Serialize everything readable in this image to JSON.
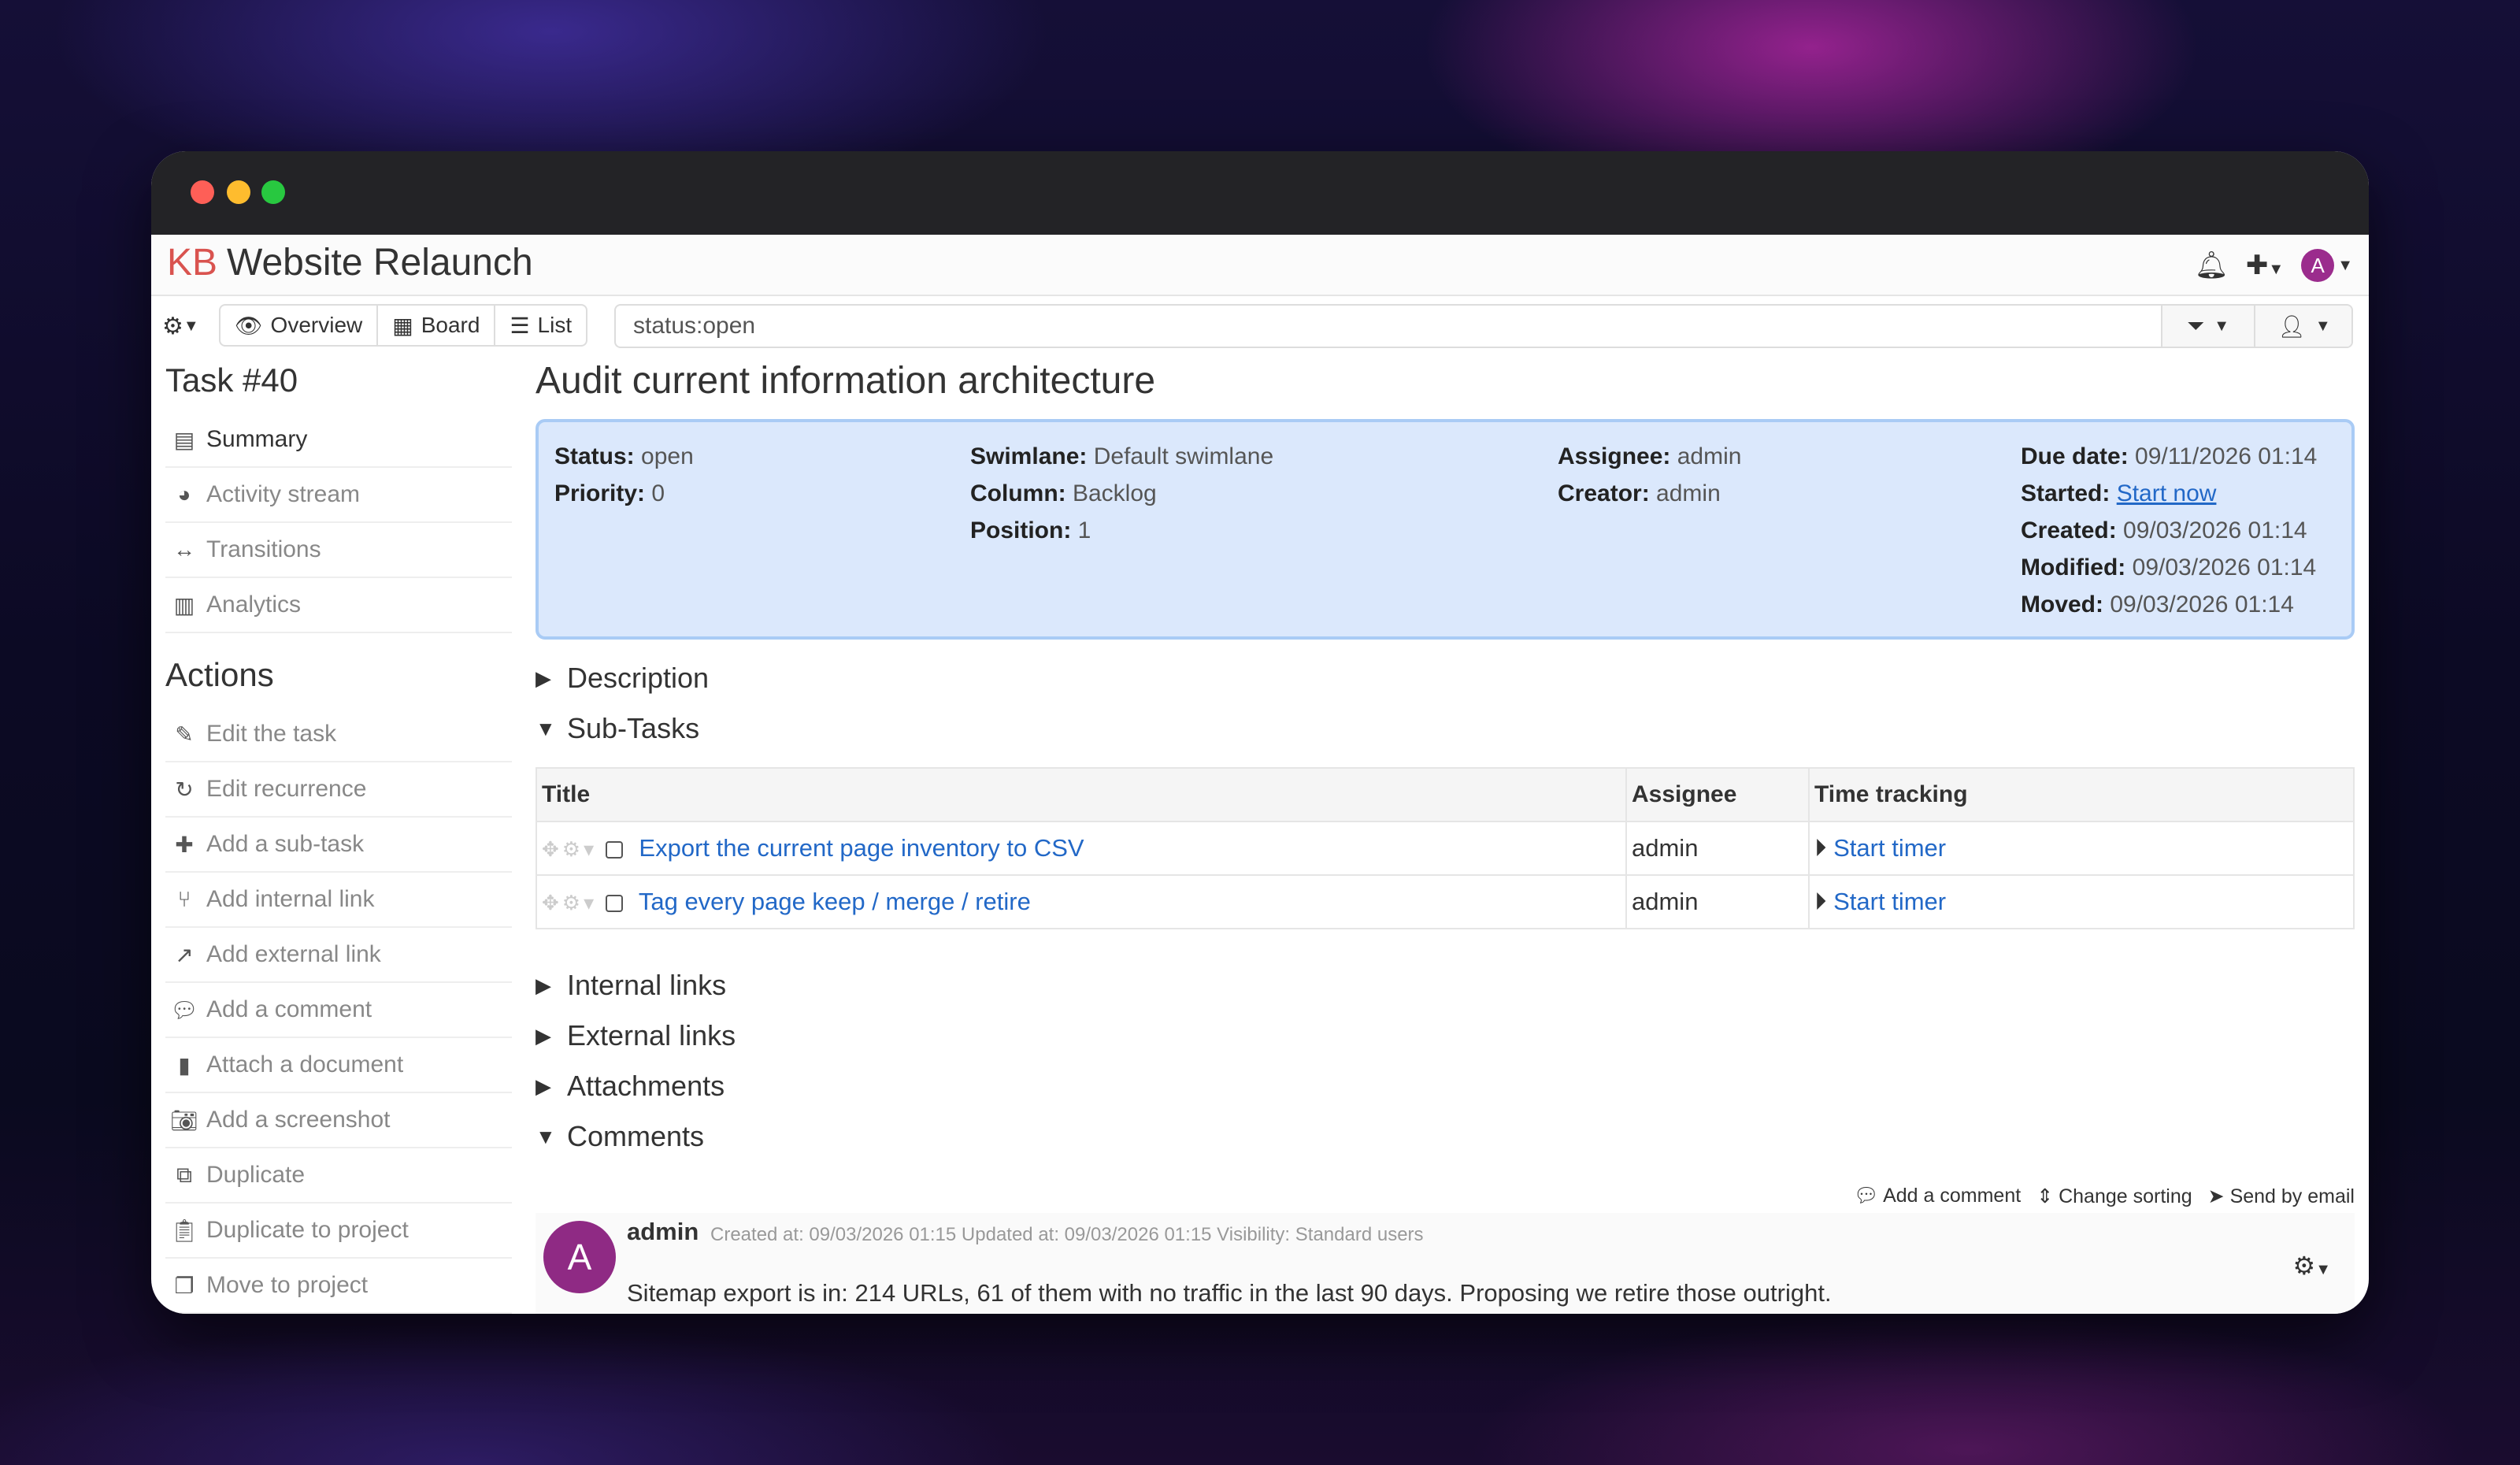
{
  "header": {
    "logo": "KB",
    "project_title": "Website Relaunch",
    "icons": [
      "bell-icon",
      "plus-icon",
      "avatar"
    ],
    "avatar_initial": "A"
  },
  "toolbar": {
    "views": [
      {
        "label": "Overview",
        "icon": "eye-icon"
      },
      {
        "label": "Board",
        "icon": "grid-icon"
      },
      {
        "label": "List",
        "icon": "list-icon"
      }
    ],
    "filter_value": "status:open"
  },
  "sidebar": {
    "task_heading": "Task #40",
    "nav": [
      {
        "label": "Summary",
        "icon": "newspaper-icon",
        "active": true
      },
      {
        "label": "Activity stream",
        "icon": "dashboard-icon"
      },
      {
        "label": "Transitions",
        "icon": "arrows-h-icon"
      },
      {
        "label": "Analytics",
        "icon": "bar-chart-icon"
      }
    ],
    "actions_heading": "Actions",
    "actions": [
      {
        "label": "Edit the task",
        "icon": "edit-icon"
      },
      {
        "label": "Edit recurrence",
        "icon": "refresh-icon"
      },
      {
        "label": "Add a sub-task",
        "icon": "plus-icon"
      },
      {
        "label": "Add internal link",
        "icon": "code-fork-icon"
      },
      {
        "label": "Add external link",
        "icon": "external-link-icon"
      },
      {
        "label": "Add a comment",
        "icon": "comment-icon"
      },
      {
        "label": "Attach a document",
        "icon": "file-icon"
      },
      {
        "label": "Add a screenshot",
        "icon": "camera-icon"
      },
      {
        "label": "Duplicate",
        "icon": "files-icon"
      },
      {
        "label": "Duplicate to project",
        "icon": "clipboard-icon"
      },
      {
        "label": "Move to project",
        "icon": "clone-icon"
      }
    ]
  },
  "task": {
    "title": "Audit current information architecture",
    "summary": {
      "status_label": "Status:",
      "status": "open",
      "priority_label": "Priority:",
      "priority": "0",
      "swimlane_label": "Swimlane:",
      "swimlane": "Default swimlane",
      "column_label": "Column:",
      "column": "Backlog",
      "position_label": "Position:",
      "position": "1",
      "assignee_label": "Assignee:",
      "assignee": "admin",
      "creator_label": "Creator:",
      "creator": "admin",
      "due_label": "Due date:",
      "due": "09/11/2026 01:14",
      "started_label": "Started:",
      "started_link": "Start now",
      "created_label": "Created:",
      "created": "09/03/2026 01:14",
      "modified_label": "Modified:",
      "modified": "09/03/2026 01:14",
      "moved_label": "Moved:",
      "moved": "09/03/2026 01:14"
    },
    "sections": {
      "description": "Description",
      "subtasks": "Sub-Tasks",
      "internal_links": "Internal links",
      "external_links": "External links",
      "attachments": "Attachments",
      "comments": "Comments"
    },
    "subtask_columns": [
      "Title",
      "Assignee",
      "Time tracking"
    ],
    "subtasks": [
      {
        "title": "Export the current page inventory to CSV",
        "assignee": "admin",
        "timer": "Start timer"
      },
      {
        "title": "Tag every page keep / merge / retire",
        "assignee": "admin",
        "timer": "Start timer"
      }
    ],
    "comment_actions": {
      "add": "Add a comment",
      "sort": "Change sorting",
      "email": "Send by email"
    },
    "comment": {
      "avatar_initial": "A",
      "user": "admin",
      "meta": "Created at: 09/03/2026 01:15 Updated at: 09/03/2026 01:15 Visibility: Standard users",
      "text": "Sitemap export is in: 214 URLs, 61 of them with no traffic in the last 90 days. Proposing we retire those outright."
    }
  }
}
